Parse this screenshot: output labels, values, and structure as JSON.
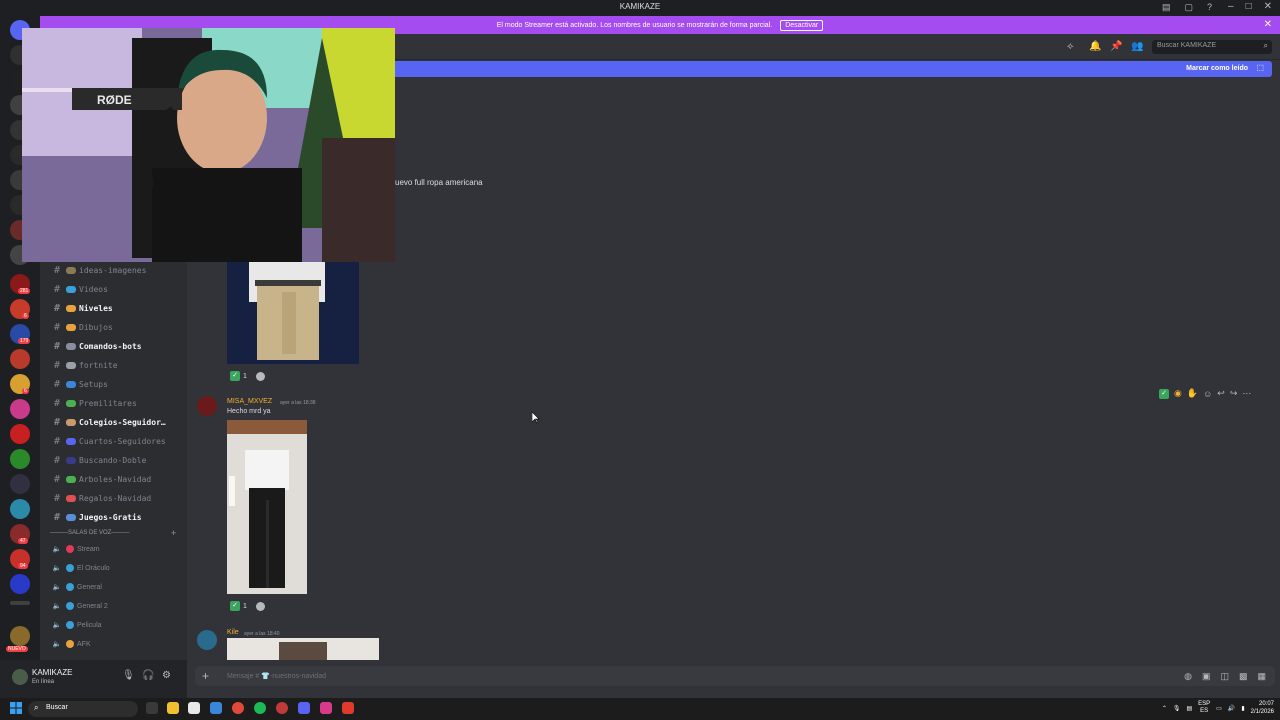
{
  "window": {
    "title": "KAMIKAZE"
  },
  "banner": {
    "text": "El modo Streamer está activado. Los nombres de usuario se mostrarán de forma parcial.",
    "button": "Desactivar"
  },
  "rail_badges": [
    "281",
    "6",
    "179",
    "6",
    "47",
    "94",
    "NUEVO"
  ],
  "webcam": {
    "mic_brand": "RØDE"
  },
  "sidebar": {
    "channels": [
      {
        "label": "ideas-imagenes",
        "bold": false,
        "color": "#8a7a55"
      },
      {
        "label": "Videos",
        "bold": false,
        "color": "#3aa0d8"
      },
      {
        "label": "Niveles",
        "bold": true,
        "color": "#e8a33c"
      },
      {
        "label": "Dibujos",
        "bold": false,
        "color": "#e8a33c"
      },
      {
        "label": "Comandos-bots",
        "bold": true,
        "color": "#8a8fa0"
      },
      {
        "label": "fortnite",
        "bold": false,
        "color": "#9aa0a8"
      },
      {
        "label": "Setups",
        "bold": false,
        "color": "#3a86d8"
      },
      {
        "label": "Premilitares",
        "bold": false,
        "color": "#4caf50"
      },
      {
        "label": "Colegios-Seguidor…",
        "bold": true,
        "color": "#c99a6a"
      },
      {
        "label": "Cuartos-Seguidores",
        "bold": false,
        "color": "#5865f2"
      },
      {
        "label": "Buscando-Doble",
        "bold": false,
        "color": "#3a3a8a"
      },
      {
        "label": "Arboles-Navidad",
        "bold": false,
        "color": "#4caf50"
      },
      {
        "label": "Regalos-Navidad",
        "bold": false,
        "color": "#e05050"
      },
      {
        "label": "Juegos-Gratis",
        "bold": true,
        "color": "#5a8fd8"
      }
    ],
    "voice_header": "SALAS DE VOZ",
    "voice_channels": [
      {
        "label": "Stream",
        "color": "#e03a5a"
      },
      {
        "label": "El Oráculo",
        "color": "#3aa0d8"
      },
      {
        "label": "General",
        "color": "#3aa0d8"
      },
      {
        "label": "General 2",
        "color": "#3aa0d8"
      },
      {
        "label": "Pelicula",
        "color": "#3aa0d8"
      },
      {
        "label": "AFK",
        "color": "#e8a33c"
      }
    ]
  },
  "user": {
    "name": "KAMIKAZE",
    "status": "En línea"
  },
  "chat": {
    "search_placeholder": "Buscar KAMIKAZE",
    "new_messages_action": "Marcar como leído",
    "partial_message": "uevo full ropa americana",
    "messages": [
      {
        "reaction_count": "1"
      },
      {
        "author": "MISA_MXVEZ",
        "timestamp": "ayer a las 18:38",
        "text": "Hecho mrd ya",
        "reaction_count": "1"
      },
      {
        "author": "Kile",
        "timestamp": "ayer a las 18:40"
      }
    ],
    "composer_placeholder": "Mensaje # 👕-nuestros-navidad"
  },
  "taskbar": {
    "search_label": "Buscar",
    "lang": "ESP",
    "lang_sub": "ES",
    "time": "20:07",
    "date": "2/1/2026"
  },
  "colors": {
    "accent": "#5865f2",
    "banner": "#a54cf0",
    "username": "#f0b232"
  }
}
